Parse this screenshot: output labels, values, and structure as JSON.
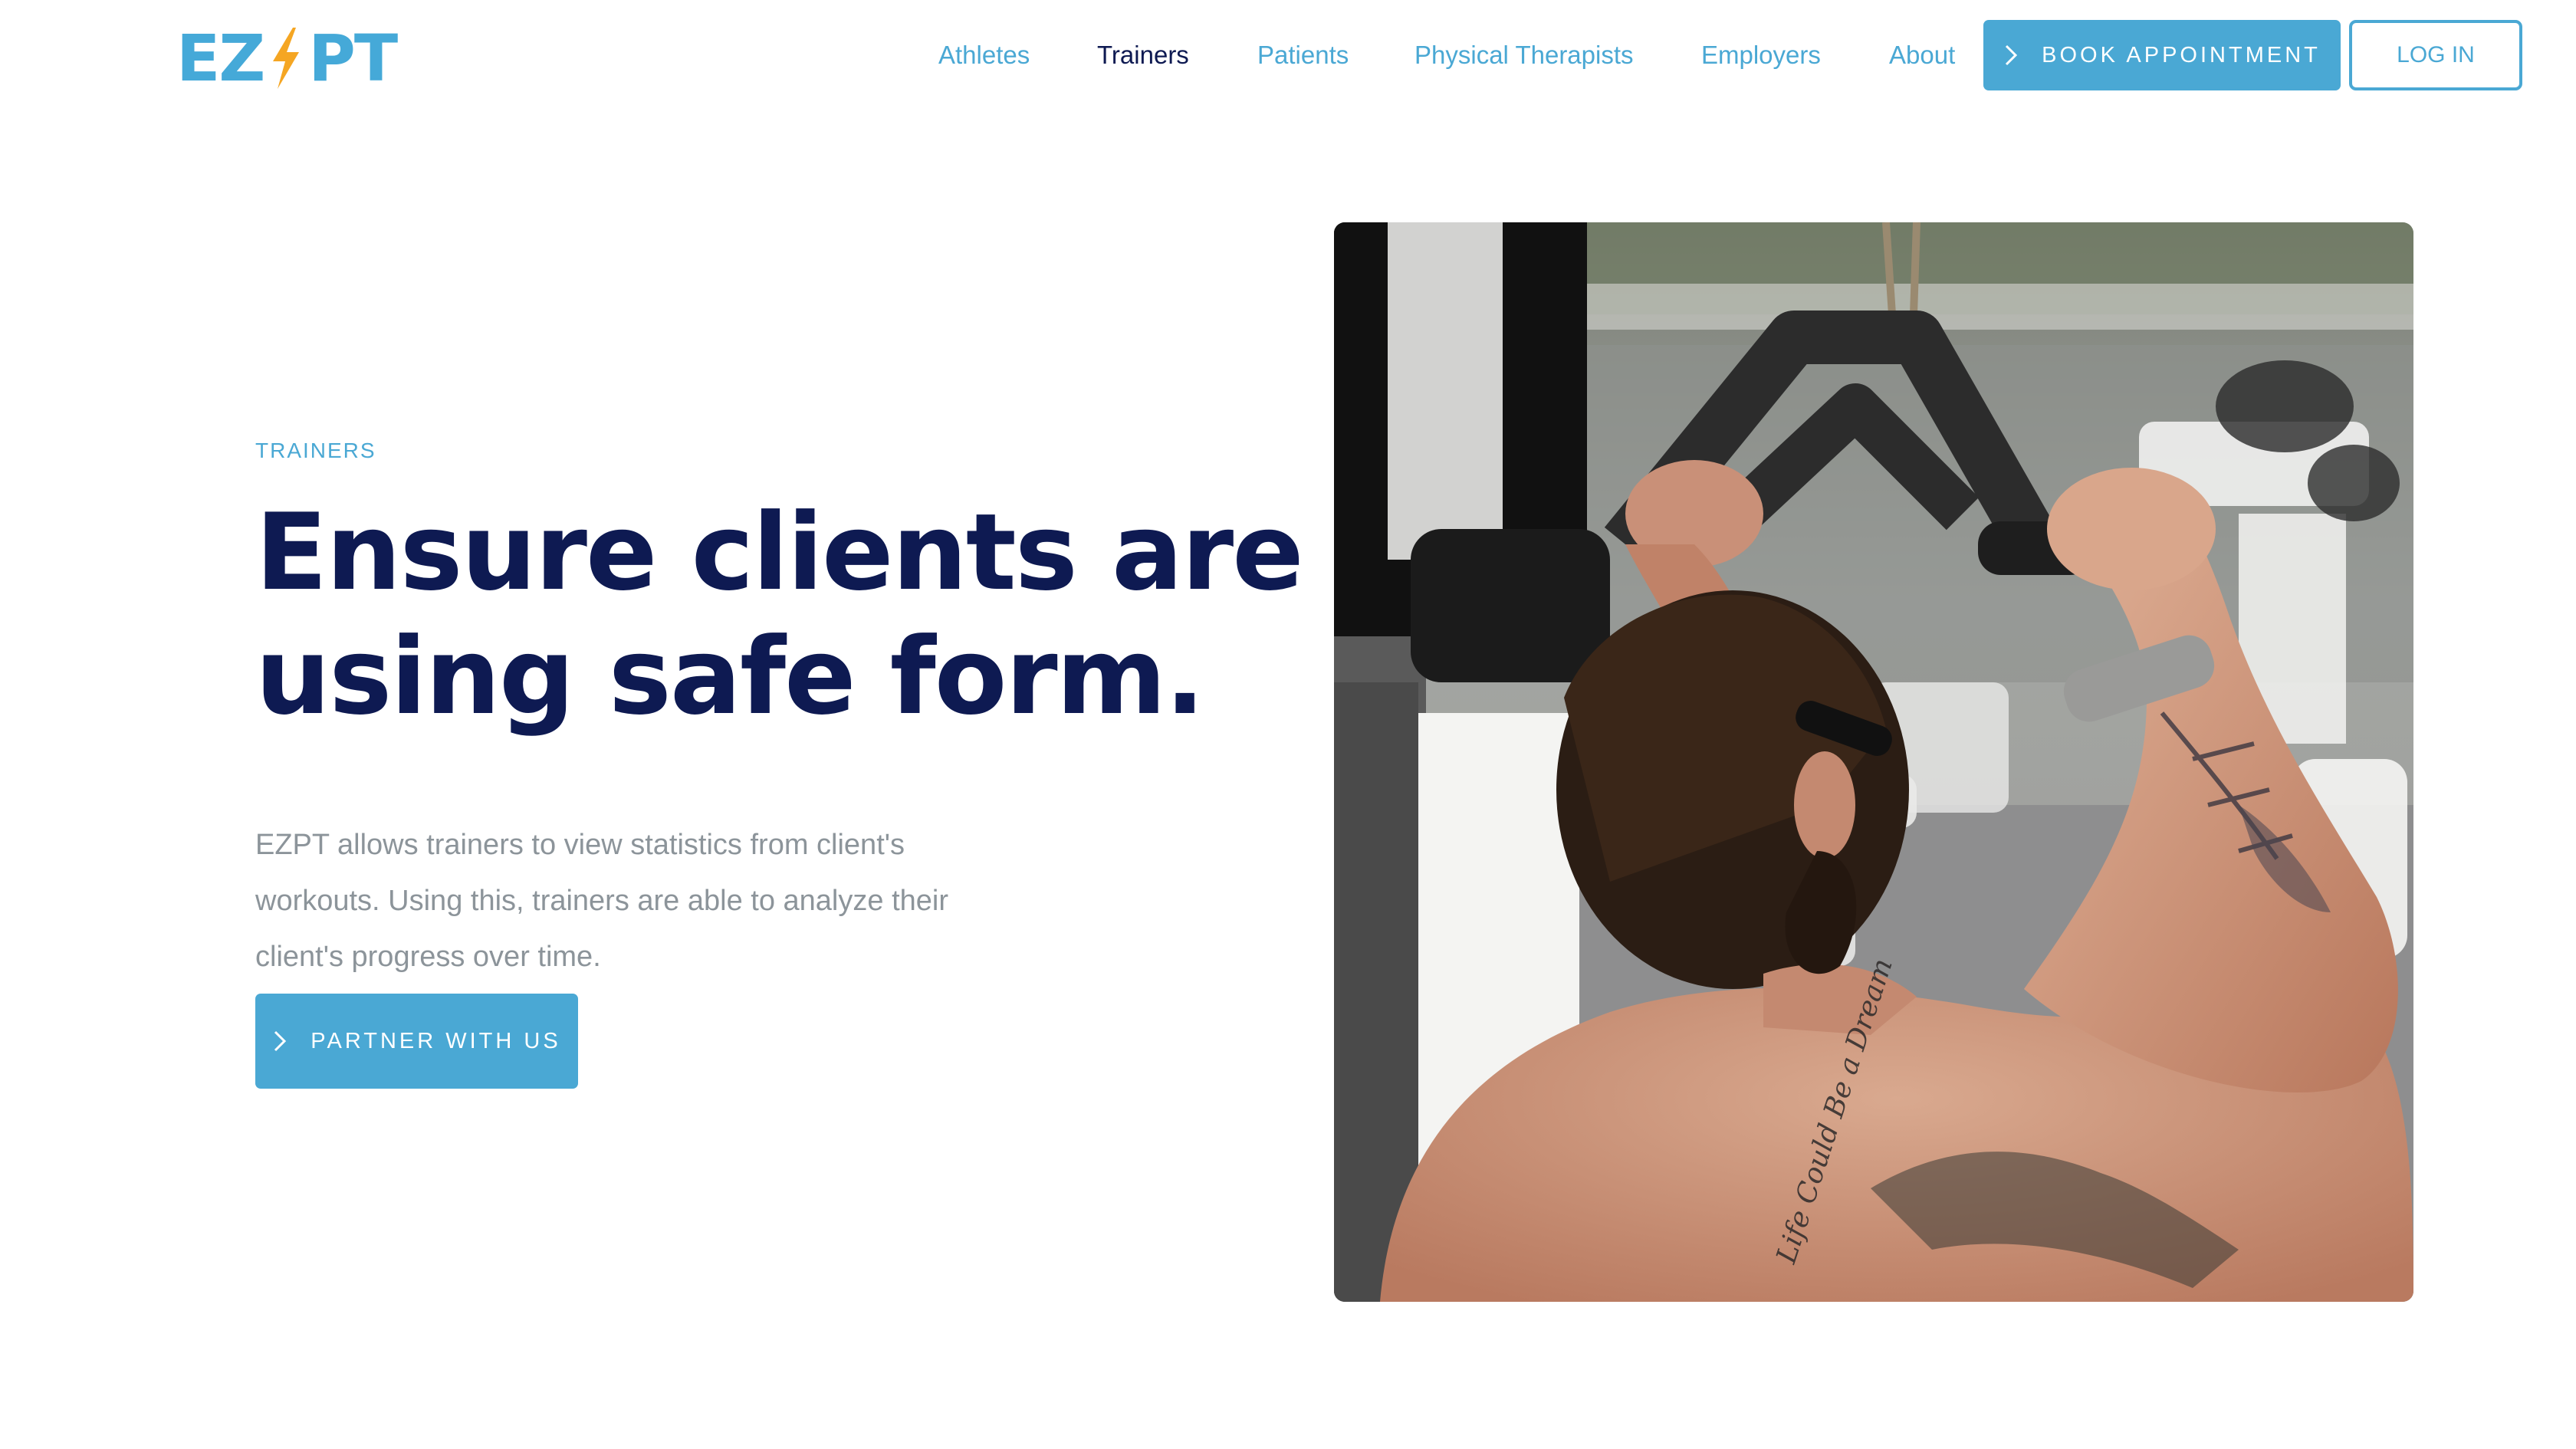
{
  "colors": {
    "accent": "#4aa8d4",
    "navy": "#0e1a52",
    "body_text": "#8c949a",
    "logo_blue": "#45a9d8",
    "bolt_yellow": "#f5a623",
    "white": "#ffffff"
  },
  "header": {
    "logo": {
      "left": "EZ",
      "right": "PT",
      "bolt_icon": "lightning-bolt-icon"
    },
    "nav": [
      {
        "label": "Athletes",
        "active": false
      },
      {
        "label": "Trainers",
        "active": true
      },
      {
        "label": "Patients",
        "active": false
      },
      {
        "label": "Physical Therapists",
        "active": false
      },
      {
        "label": "Employers",
        "active": false
      },
      {
        "label": "About",
        "active": false
      }
    ],
    "book_button": {
      "label": "BOOK APPOINTMENT",
      "icon": "chevron-right-icon"
    },
    "login_button": {
      "label": "LOG IN"
    }
  },
  "hero": {
    "eyebrow": "TRAINERS",
    "headline_line1": "Ensure clients are",
    "headline_line2": "using safe form.",
    "description": "EZPT allows trainers to view statistics from client's workouts. Using this, trainers are able to analyze their client's progress over time.",
    "cta": {
      "label": "PARTNER WITH US",
      "icon": "chevron-right-icon"
    },
    "image_subject": "tattooed man doing cable lat pulldown in gym",
    "tattoo_text": "Life Could Be a Dream"
  }
}
